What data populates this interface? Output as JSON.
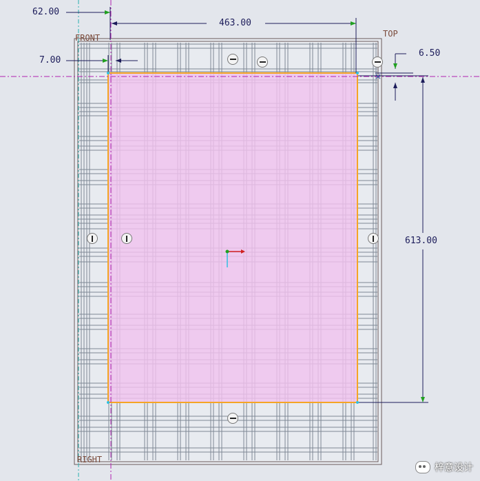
{
  "dimensions": {
    "left_offset": "62.00",
    "width": "463.00",
    "inner_offset": "7.00",
    "top_offset": "6.50",
    "height": "613.00"
  },
  "planes": {
    "front": "FRONT",
    "top": "TOP",
    "right": "RIGHT"
  },
  "icons": {
    "horizontal_constraint": "horizontal-constraint-icon",
    "vertical_constraint": "vertical-constraint-icon",
    "coordinate_system": "coordinate-system-icon"
  },
  "colors": {
    "sketch_fill": "#f0c2ee",
    "sketch_outline": "#f5a524",
    "grid_lines": "#7e8794",
    "dimension_lines": "#1c1c5a",
    "datum_axis": "#b020b0",
    "background": "#e3e6ec"
  },
  "watermark": {
    "text": "梓意设计"
  }
}
